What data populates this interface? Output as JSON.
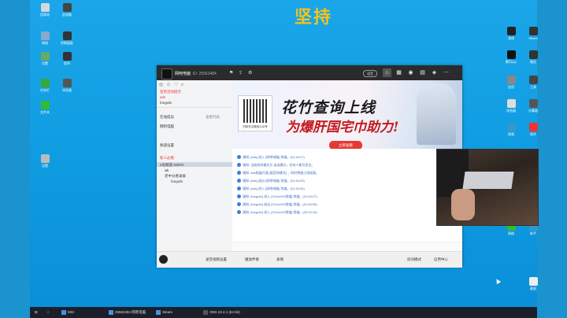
{
  "wallpaper": {
    "text": "坚持",
    "accent": "#f4c418"
  },
  "window": {
    "title_name": "网吧电脑",
    "id_text": "ID: 25563484",
    "status_pill": "语音",
    "nav": [
      "home-icon",
      "grid-icon",
      "gamepad-icon",
      "film-icon",
      "shield-icon",
      "more-icon"
    ]
  },
  "left_panel": {
    "rows": [
      {
        "text": "签到活动提示",
        "red": true
      },
      {
        "text": "ads"
      },
      {
        "text": "fongxilv"
      },
      {
        "text": "网吧电脑"
      },
      {
        "text": "频道设置"
      },
      {
        "text": "新人必看",
        "red": true
      },
      {
        "text": "2号频道·20970"
      },
      {
        "text": "wk"
      },
      {
        "text": "老中分者录屏"
      },
      {
        "text": "fongxilv"
      }
    ],
    "section_label": "在线成员",
    "section_hint": "查看列表"
  },
  "banner": {
    "slogan1": "花竹查询上线",
    "slogan2": "为爆肝国宅巾助力!",
    "cta": "立即查看",
    "qr_caption": "扫码关注微信公众号"
  },
  "chat": {
    "messages": [
      "通知: [ads] 进入 [网吧电脑] 频道。(01:45:27)",
      "通知: 当前房间模式为 自由模式，任何人都可发言。",
      "通知: ads频道开通 [高音质模式] ，同时将使占用较高。",
      "通知: [ads] 退出 [网吧电脑] 频道。(01:45:29)",
      "通知: [ads] 进入 [网吧电脑] 频道。(01:45:34)",
      "通知: [fongxilv] 进入 [2Gnu%%频道] 频道。(01:53:27)",
      "通知: [fongxilv] 退出 [2Gnu%%频道] 频道。(01:56:55)",
      "通知: [fongxilv] 进入 [2Gnu%%频道] 频道。(02:02:16)"
    ]
  },
  "bottom_bar": {
    "items": [
      "录音视频设置",
      "播放伴奏",
      "表情"
    ],
    "right": [
      "房间模式",
      "应用中心"
    ]
  },
  "taskbar": {
    "items": [
      "MSI",
      "25563484 网吧电脑",
      "Steam",
      "OBS 23.2.1 (64-bit)"
    ]
  },
  "desktop_icons_left": [
    "回收站",
    "此电脑",
    "网络",
    "控制面板",
    "设置",
    "程序",
    "任务栏",
    "浏览器",
    "文件夹",
    "设置"
  ],
  "desktop_icons_right": [
    "游戏",
    "Steam",
    "腾讯QQ",
    "微信",
    "应用",
    "工具",
    "浏览器",
    "计算器",
    "视频",
    "软件",
    "网络",
    "助手",
    "截图"
  ]
}
